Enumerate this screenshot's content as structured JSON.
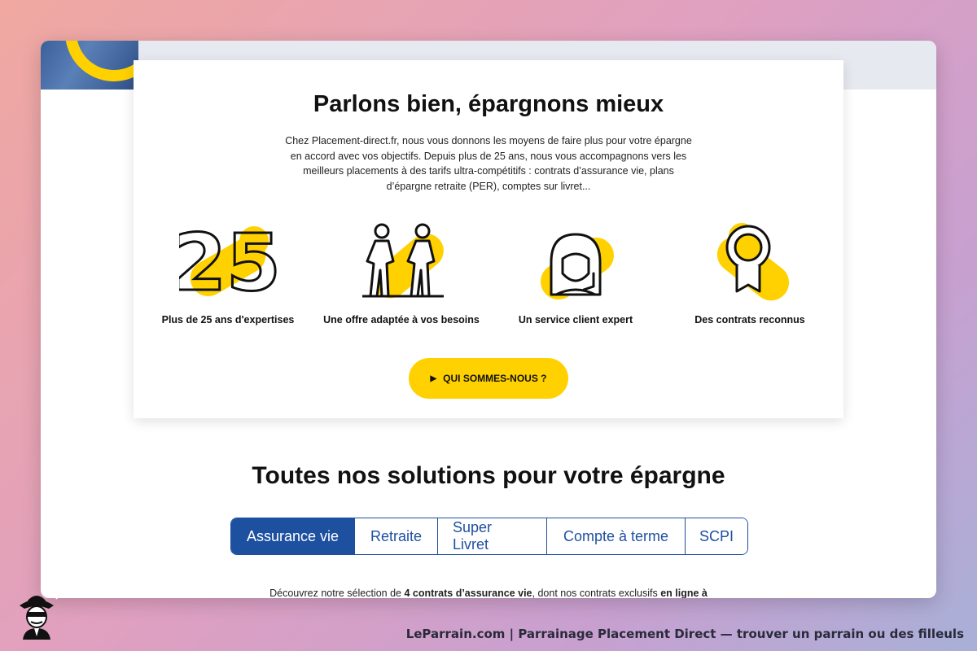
{
  "card": {
    "title": "Parlons bien, épargnons mieux",
    "intro": "Chez Placement-direct.fr, nous vous donnons les moyens de faire plus pour votre épargne en accord avec vos objectifs. Depuis plus de 25 ans, nous vous accompagnons vers les meilleurs placements à des tarifs ultra-compétitifs : contrats d’assurance vie, plans d’épargne retraite (PER), comptes sur livret...",
    "features": [
      {
        "label": "Plus de 25 ans d'expertises",
        "icon": "twenty-five-icon",
        "number": "25"
      },
      {
        "label": "Une offre adaptée à vos besoins",
        "icon": "two-walkers-icon"
      },
      {
        "label": "Un service client expert",
        "icon": "headset-agent-icon"
      },
      {
        "label": "Des contrats reconnus",
        "icon": "award-medal-icon"
      }
    ],
    "cta_label": "QUI SOMMES-NOUS ?"
  },
  "solutions": {
    "title": "Toutes nos solutions pour votre épargne",
    "tabs": [
      "Assurance vie",
      "Retraite",
      "Super Livret",
      "Compte à terme",
      "SCPI"
    ],
    "active_tab": "Assurance vie",
    "intro_part1": "Découvrez notre sélection de ",
    "intro_bold1": "4 contrats d’assurance vie",
    "intro_part2": ", dont nos contrats exclusifs ",
    "intro_bold2": "en ligne à"
  },
  "footer": {
    "caption": "LeParrain.com | Parrainage Placement Direct — trouver un parrain ou des filleuls"
  },
  "colors": {
    "accent_yellow": "#ffd100",
    "brand_blue": "#1e50a0"
  }
}
